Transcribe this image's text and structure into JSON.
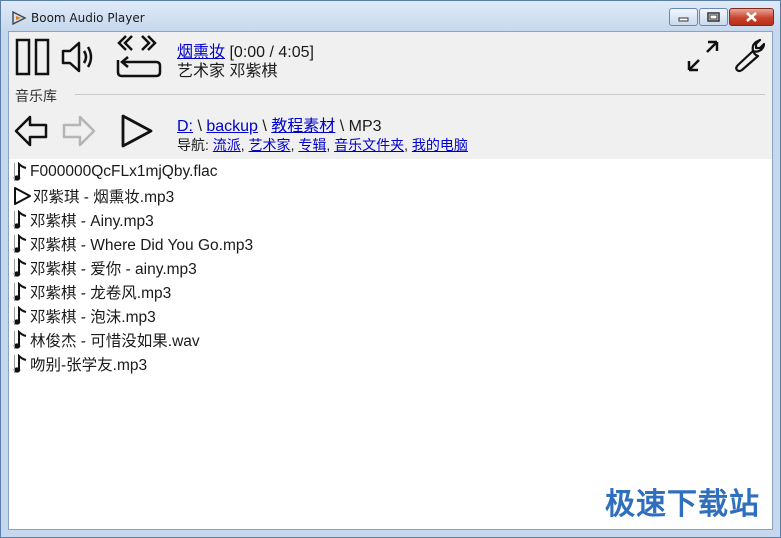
{
  "window": {
    "title": "Boom Audio Player"
  },
  "player": {
    "track_title": "烟熏妆",
    "time": "[0:00 / 4:05]",
    "artist": "艺术家 邓紫棋"
  },
  "library": {
    "label": "音乐库",
    "path": [
      {
        "text": "D:",
        "link": true
      },
      {
        "text": " \\ ",
        "link": false
      },
      {
        "text": "backup",
        "link": true
      },
      {
        "text": " \\ ",
        "link": false
      },
      {
        "text": "教程素材",
        "link": true
      },
      {
        "text": " \\ ",
        "link": false
      },
      {
        "text": "MP3",
        "link": false
      }
    ],
    "nav_label": "导航:",
    "nav_links": [
      "流派",
      "艺术家",
      "专辑",
      "音乐文件夹",
      "我的电脑"
    ]
  },
  "files": [
    {
      "name": "F000000QcFLx1mjQby.flac",
      "icon": "note-icon"
    },
    {
      "name": "邓紫琪 - 烟熏妆.mp3",
      "icon": "play-icon"
    },
    {
      "name": "邓紫棋 - Ainy.mp3",
      "icon": "note-icon"
    },
    {
      "name": "邓紫棋 - Where Did You Go.mp3",
      "icon": "note-icon"
    },
    {
      "name": "邓紫棋 - 爱你 - ainy.mp3",
      "icon": "note-icon"
    },
    {
      "name": "邓紫棋 - 龙卷风.mp3",
      "icon": "note-icon"
    },
    {
      "name": "邓紫棋 - 泡沫.mp3",
      "icon": "note-icon"
    },
    {
      "name": "林俊杰 - 可惜没如果.wav",
      "icon": "note-icon"
    },
    {
      "name": "吻别-张学友.mp3",
      "icon": "note-icon"
    }
  ],
  "watermark": "极速下载站",
  "colors": {
    "link": "#0000cc",
    "toolbar_bg": "#f0f0f0",
    "watermark": "#2f6fbd"
  }
}
